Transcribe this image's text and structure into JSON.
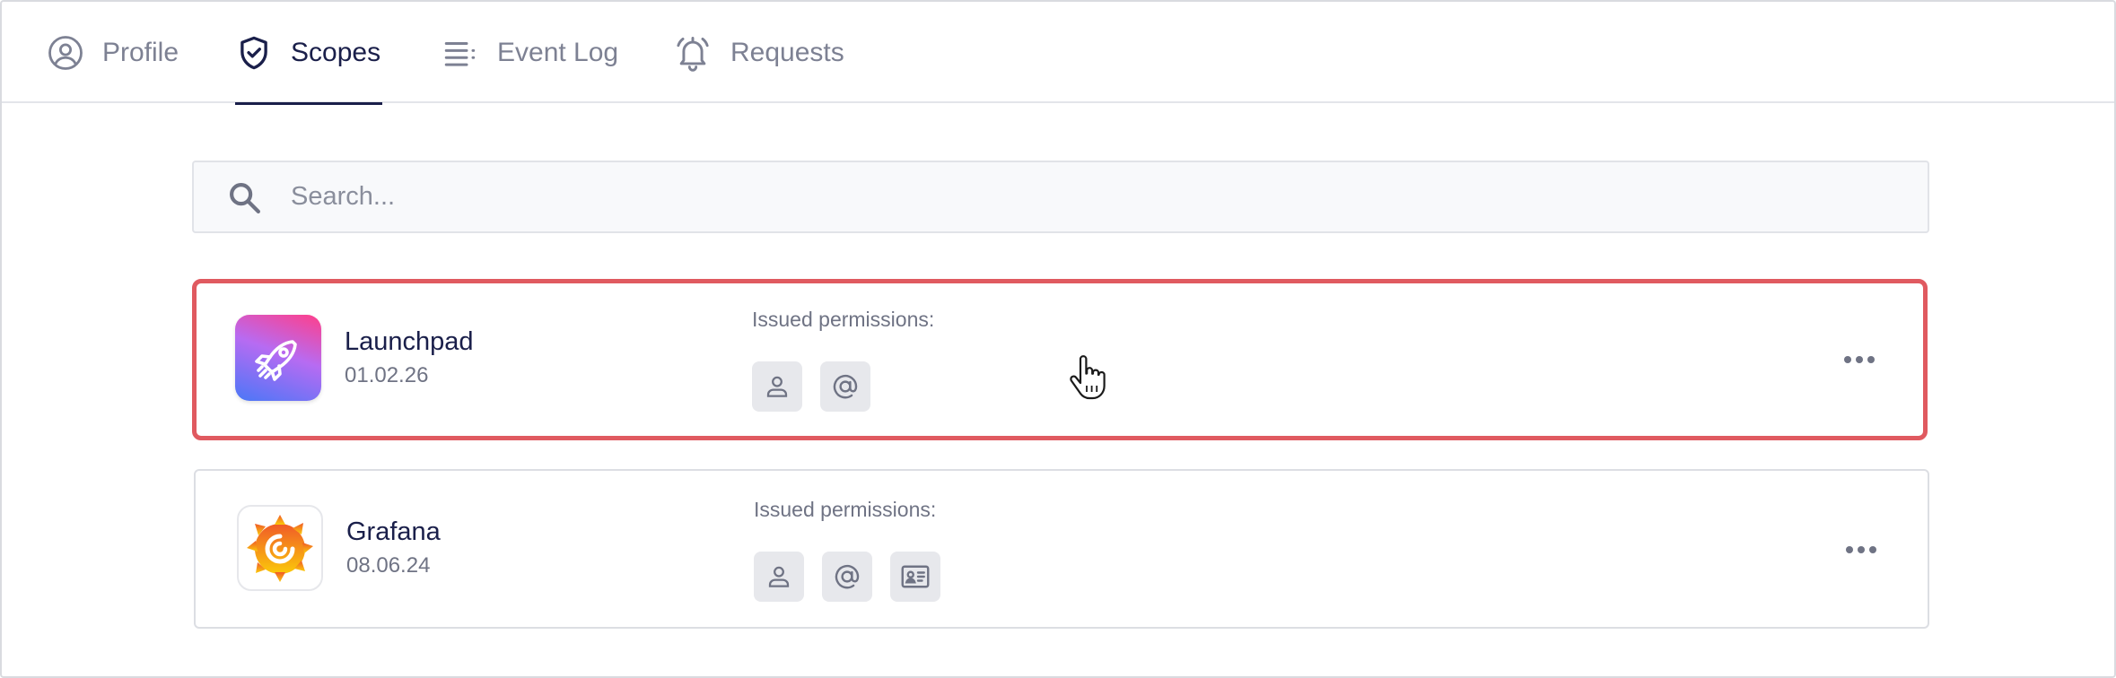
{
  "tabs": [
    {
      "label": "Profile",
      "icon": "user-circle-icon",
      "active": false
    },
    {
      "label": "Scopes",
      "icon": "shield-check-icon",
      "active": true
    },
    {
      "label": "Event Log",
      "icon": "list-icon",
      "active": false
    },
    {
      "label": "Requests",
      "icon": "bell-ring-icon",
      "active": false
    }
  ],
  "search": {
    "placeholder": "Search...",
    "value": ""
  },
  "scopes": [
    {
      "name": "Launchpad",
      "date": "01.02.26",
      "permissions_label": "Issued permissions:",
      "permissions": [
        "user-icon",
        "at-sign-icon"
      ],
      "selected": true,
      "highlight_color": "#e05a60"
    },
    {
      "name": "Grafana",
      "date": "08.06.24",
      "permissions_label": "Issued permissions:",
      "permissions": [
        "user-icon",
        "at-sign-icon",
        "id-card-icon"
      ],
      "selected": false
    }
  ],
  "colors": {
    "text_primary": "#1a1f4a",
    "text_muted": "#7d8193",
    "selection": "#e05a60"
  }
}
